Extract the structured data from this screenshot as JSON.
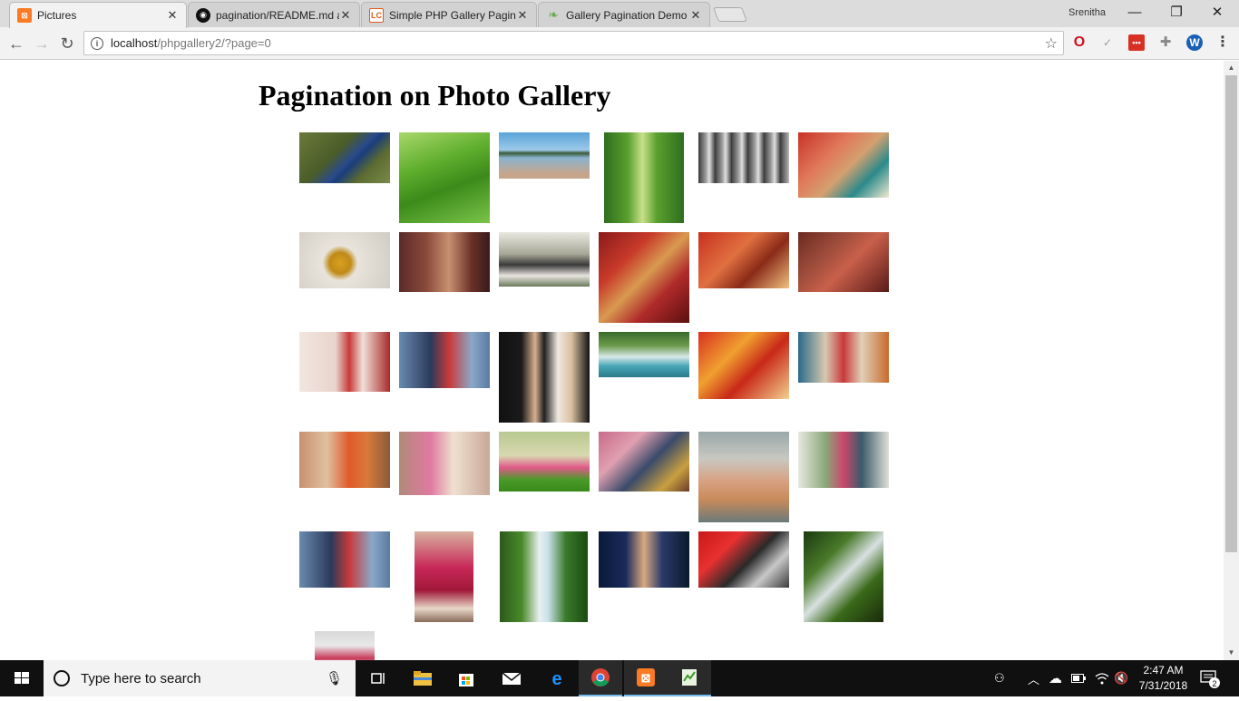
{
  "browser": {
    "tabs": [
      {
        "title": "Pictures",
        "active": true,
        "favicon": "XAMPP"
      },
      {
        "title": "pagination/README.md a",
        "active": false,
        "favicon": "GH"
      },
      {
        "title": "Simple PHP Gallery Pagin",
        "active": false,
        "favicon": "LC"
      },
      {
        "title": "Gallery Pagination Demo",
        "active": false,
        "favicon": "leaf"
      }
    ],
    "profile_name": "Srenitha",
    "url_host": "localhost",
    "url_path": "/phpgallery2/?page=0"
  },
  "page": {
    "title": "Pagination on Photo Gallery"
  },
  "taskbar": {
    "search_placeholder": "Type here to search",
    "time": "2:47 AM",
    "date": "7/31/2018",
    "notification_count": "2"
  },
  "colors": {
    "chrome_bg": "#f2f2f2",
    "tabstrip_bg": "#dcdcdc",
    "taskbar_bg": "#101010",
    "accent_blue": "#76b9ed"
  }
}
